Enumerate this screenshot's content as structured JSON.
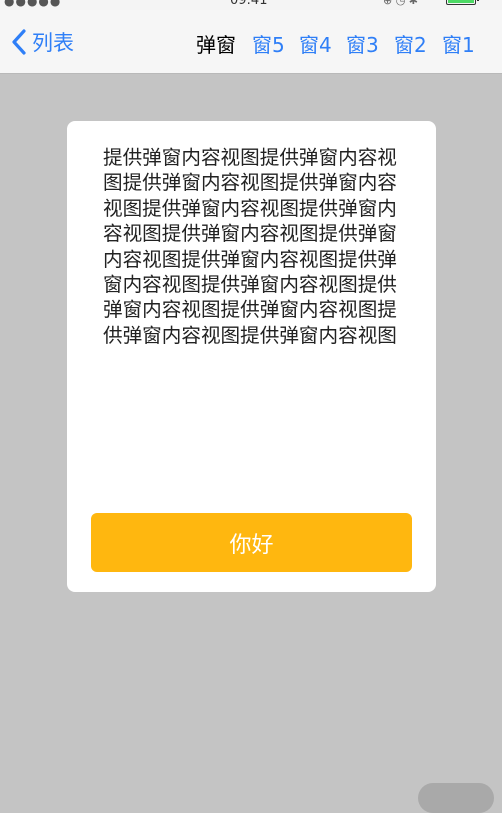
{
  "status_bar": {
    "signal": "●●●●● ",
    "time": "09:41",
    "icons": "⊕ ◷ ✱",
    "battery_color": "#4cd964"
  },
  "nav": {
    "back_label": "列表",
    "title": "弹窗",
    "items": [
      "窗5",
      "窗4",
      "窗3",
      "窗2",
      "窗1"
    ],
    "accent_color": "#2f7ff7"
  },
  "dialog": {
    "content": "提供弹窗内容视图提供弹窗内容视图提供弹窗内容视图提供弹窗内容视图提供弹窗内容视图提供弹窗内容视图提供弹窗内容视图提供弹窗内容视图提供弹窗内容视图提供弹窗内容视图提供弹窗内容视图提供弹窗内容视图提供弹窗内容视图提供弹窗内容视图提供弹窗内容视图",
    "button_label": "你好",
    "button_color": "#ffb70f"
  }
}
